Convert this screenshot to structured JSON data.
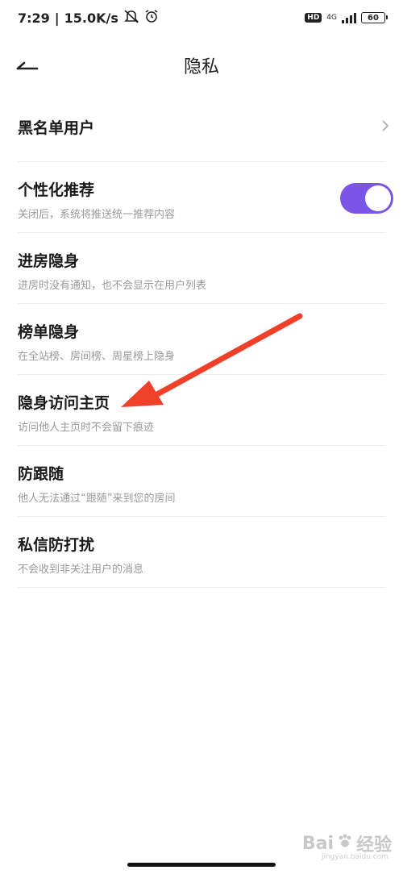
{
  "status_bar": {
    "time": "7:29",
    "separator": "|",
    "speed": "15.0K/s",
    "hd": "HD",
    "network": "4G",
    "battery": "60"
  },
  "header": {
    "title": "隐私"
  },
  "settings": [
    {
      "title": "黑名单用户",
      "subtitle": ""
    },
    {
      "title": "个性化推荐",
      "subtitle": "关闭后，系统将推送统一推荐内容",
      "toggle_on": true
    },
    {
      "title": "进房隐身",
      "subtitle": "进房时没有通知，也不会显示在用户列表"
    },
    {
      "title": "榜单隐身",
      "subtitle": "在全站榜、房间榜、周星榜上隐身"
    },
    {
      "title": "隐身访问主页",
      "subtitle": "访问他人主页时不会留下痕迹"
    },
    {
      "title": "防跟随",
      "subtitle": "他人无法通过“跟随”来到您的房间"
    },
    {
      "title": "私信防打扰",
      "subtitle": "不会收到非关注用户的消息"
    }
  ],
  "colors": {
    "accent": "#7b55e6",
    "annotation_arrow": "#f0402a"
  },
  "watermark": {
    "brand": "Bai",
    "brand_tail": "经验",
    "url": "jingyan.baidu.com"
  }
}
